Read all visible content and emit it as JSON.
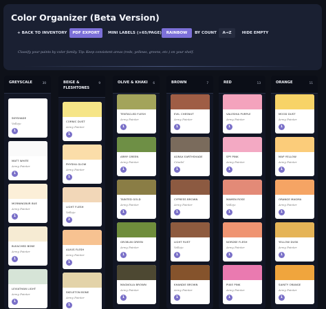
{
  "app": {
    "title": "Color Organizer (Beta Version)"
  },
  "toolbar": {
    "back_label": "+ BACK TO INVENTORY",
    "pdf_label": "PDF EXPORT",
    "mini_labels_label": "MINI LABELS (×65/PAGE)",
    "rainbow_label": "RAINBOW",
    "by_count_label": "BY COUNT",
    "az_label": "A→Z",
    "hide_empty_label": "HIDE EMPTY"
  },
  "hint": "Classify your paints by color family. Tip: Keep consistent areas (reds, yellows, greens, etc.) on your shelf.",
  "columns": [
    {
      "name": "GREYSCALE",
      "count": "30",
      "cards": [
        {
          "name": "SKYSHADE",
          "brand": "Vallejo",
          "qty": "1",
          "color": "#ffffff"
        },
        {
          "name": "MATT WHITE",
          "brand": "Army Painter",
          "qty": "1",
          "color": "#fafafa"
        },
        {
          "name": "MORNINGBUR BUE",
          "brand": "Army Painter",
          "qty": "1",
          "color": "#fcefd8"
        },
        {
          "name": "BLEACHED BONE",
          "brand": "Army Painter",
          "qty": "1",
          "color": "#f6ebd3"
        },
        {
          "name": "LEVIATHAN LIGHT",
          "brand": "Army Painter",
          "qty": "1",
          "color": "#d6e4d7"
        }
      ]
    },
    {
      "name": "BEIGE & FLESHTONES",
      "count": "9",
      "cards": [
        {
          "name": "CORNIC DUST",
          "brand": "Army Painter",
          "qty": "1",
          "color": "#f6e587"
        },
        {
          "name": "PHYSHA GLOW",
          "brand": "Army Painter",
          "qty": "1",
          "color": "#fbdda9"
        },
        {
          "name": "LIGHT FLESH",
          "brand": "Vallejo",
          "qty": "2",
          "color": "#f2d7b8"
        },
        {
          "name": "ALVUS FLESH",
          "brand": "Army Painter",
          "qty": "1",
          "color": "#f7c291"
        },
        {
          "name": "SKELETON BONE",
          "brand": "Army Painter",
          "qty": "1",
          "color": "#e3d3a9"
        }
      ]
    },
    {
      "name": "OLIVE & KHAKI",
      "count": "6",
      "cards": [
        {
          "name": "TENTACLED FLESH",
          "brand": "Army Painter",
          "qty": "1",
          "color": "#a3a45b"
        },
        {
          "name": "ARMY GREEN",
          "brand": "Army Painter",
          "qty": "1",
          "color": "#6e8f45"
        },
        {
          "name": "TAINTED GOLD",
          "brand": "Army Painter",
          "qty": "1",
          "color": "#8a7d45"
        },
        {
          "name": "GROBLIN GREEN",
          "brand": "Army Painter",
          "qty": "1",
          "color": "#6f8d3c"
        },
        {
          "name": "MAGNOLIA BROWN",
          "brand": "Army Painter",
          "qty": "1",
          "color": "#4d4832"
        }
      ]
    },
    {
      "name": "BROWN",
      "count": "7",
      "cards": [
        {
          "name": "EVIL CHESNUT",
          "brand": "Army Painter",
          "qty": "1",
          "color": "#9f5d45"
        },
        {
          "name": "AGRAX EARTHSHADE",
          "brand": "Citadel",
          "qty": "1",
          "color": "#7a6b5c"
        },
        {
          "name": "CYPRESS BROWN",
          "brand": "Army Painter",
          "qty": "1",
          "color": "#8c5a41"
        },
        {
          "name": "LIGHT RUST",
          "brand": "Vallejo",
          "qty": "1",
          "color": "#8e5b3f"
        },
        {
          "name": "KHANDIE BROWN",
          "brand": "Army Painter",
          "qty": "1",
          "color": "#85532c"
        }
      ]
    },
    {
      "name": "RED",
      "count": "13",
      "cards": [
        {
          "name": "VALESHIA PURPLE",
          "brand": "Army Painter",
          "qty": "1",
          "color": "#f4a3bd"
        },
        {
          "name": "SPY PINK",
          "brand": "Army Painter",
          "qty": "1",
          "color": "#f3a9c3"
        },
        {
          "name": "MAMEN ROSE",
          "brand": "Vallejo",
          "qty": "1",
          "color": "#e38a77"
        },
        {
          "name": "NORDSE FLESH",
          "brand": "Army Painter",
          "qty": "1",
          "color": "#ef9472"
        },
        {
          "name": "PIXIE PINK",
          "brand": "Army Painter",
          "qty": "1",
          "color": "#ea7ab0"
        }
      ]
    },
    {
      "name": "ORANGE",
      "count": "11",
      "cards": [
        {
          "name": "MOOD DUST",
          "brand": "Army Painter",
          "qty": "1",
          "color": "#f7d367"
        },
        {
          "name": "MAP YELLOW",
          "brand": "Army Painter",
          "qty": "1",
          "color": "#fbcc7a"
        },
        {
          "name": "ORANGE MAGMA",
          "brand": "Army Painter",
          "qty": "1",
          "color": "#f5a464"
        },
        {
          "name": "YELLOW DUSK",
          "brand": "Army Painter",
          "qty": "1",
          "color": "#e5b457"
        },
        {
          "name": "SAINTY ORANGE",
          "brand": "Army Painter",
          "qty": "1",
          "color": "#f0a53d"
        }
      ]
    }
  ]
}
